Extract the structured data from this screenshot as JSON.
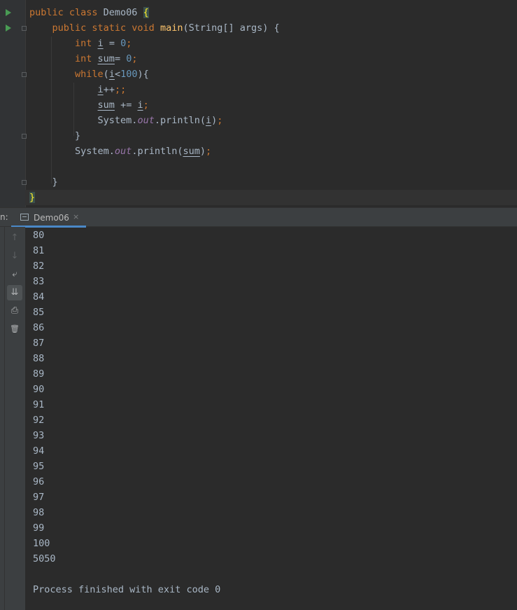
{
  "editor": {
    "lines": [
      {
        "parts": [
          [
            "kw",
            "public class "
          ],
          [
            "plain",
            "Demo06 "
          ],
          [
            "bhl",
            "{"
          ]
        ]
      },
      {
        "parts": [
          [
            "plain",
            "    "
          ],
          [
            "kw",
            "public static void "
          ],
          [
            "fn",
            "main"
          ],
          [
            "plain",
            "(String[] args) {"
          ]
        ]
      },
      {
        "parts": [
          [
            "plain",
            "        "
          ],
          [
            "kw",
            "int "
          ],
          [
            "ul",
            "i"
          ],
          [
            "plain",
            " = "
          ],
          [
            "num",
            "0"
          ],
          [
            "kw",
            ";"
          ]
        ]
      },
      {
        "parts": [
          [
            "plain",
            "        "
          ],
          [
            "kw",
            "int "
          ],
          [
            "ul",
            "sum"
          ],
          [
            "plain",
            "= "
          ],
          [
            "num",
            "0"
          ],
          [
            "kw",
            ";"
          ]
        ]
      },
      {
        "parts": [
          [
            "plain",
            "        "
          ],
          [
            "kw",
            "while"
          ],
          [
            "plain",
            "("
          ],
          [
            "ul",
            "i"
          ],
          [
            "plain",
            "<"
          ],
          [
            "num",
            "100"
          ],
          [
            "plain",
            "){"
          ]
        ]
      },
      {
        "parts": [
          [
            "plain",
            "            "
          ],
          [
            "ul",
            "i"
          ],
          [
            "plain",
            "++"
          ],
          [
            "kw",
            ";;"
          ]
        ]
      },
      {
        "parts": [
          [
            "plain",
            "            "
          ],
          [
            "ul",
            "sum"
          ],
          [
            "plain",
            " += "
          ],
          [
            "ul",
            "i"
          ],
          [
            "kw",
            ";"
          ]
        ]
      },
      {
        "parts": [
          [
            "plain",
            "            System."
          ],
          [
            "fld",
            "out"
          ],
          [
            "plain",
            ".println("
          ],
          [
            "ul",
            "i"
          ],
          [
            "plain",
            ")"
          ],
          [
            "kw",
            ";"
          ]
        ]
      },
      {
        "parts": [
          [
            "plain",
            "        }"
          ]
        ]
      },
      {
        "parts": [
          [
            "plain",
            "        System."
          ],
          [
            "fld",
            "out"
          ],
          [
            "plain",
            ".println("
          ],
          [
            "ul",
            "sum"
          ],
          [
            "plain",
            ")"
          ],
          [
            "kw",
            ";"
          ]
        ]
      },
      {
        "parts": [
          [
            "plain",
            ""
          ]
        ]
      },
      {
        "parts": [
          [
            "plain",
            "    }"
          ]
        ]
      },
      {
        "parts": [
          [
            "bhl",
            "}"
          ]
        ]
      }
    ]
  },
  "run_panel": {
    "label": "n:",
    "tab_label": "Demo06",
    "close_glyph": "×"
  },
  "toolbar": {
    "up": "↑",
    "down": "↓",
    "soft_wrap": "⤶",
    "scroll_end": "⇊",
    "print": "⎙",
    "clear": "🗑"
  },
  "console": {
    "lines": [
      "80",
      "81",
      "82",
      "83",
      "84",
      "85",
      "86",
      "87",
      "88",
      "89",
      "90",
      "91",
      "92",
      "93",
      "94",
      "95",
      "96",
      "97",
      "98",
      "99",
      "100",
      "5050",
      "",
      "Process finished with exit code 0"
    ]
  },
  "colors": {
    "keyword": "#cc7832",
    "number": "#6897bb",
    "method": "#ffc66d",
    "field": "#9876aa",
    "text": "#a9b7c6",
    "run_arrow": "#499c54"
  }
}
